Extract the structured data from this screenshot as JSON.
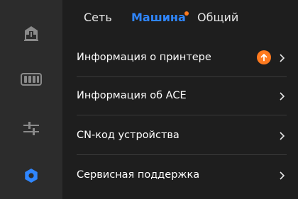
{
  "sidebar": {
    "items": [
      {
        "icon": "printer-icon",
        "active": false
      },
      {
        "icon": "spool-rack-icon",
        "active": false
      },
      {
        "icon": "sliders-icon",
        "active": false
      },
      {
        "icon": "gear-icon",
        "active": true
      }
    ]
  },
  "tabs": [
    {
      "label": "Сеть",
      "active": false
    },
    {
      "label": "Машина",
      "active": true,
      "notification_dot": true
    },
    {
      "label": "Общий",
      "active": false
    }
  ],
  "menu": {
    "items": [
      {
        "label": "Информация о принтере",
        "update_badge": "arrow-up-icon"
      },
      {
        "label": "Информация об ACE"
      },
      {
        "label": "CN-код устройства"
      },
      {
        "label": "Сервисная поддержка"
      }
    ]
  },
  "colors": {
    "accent": "#2f86ff",
    "badge": "#ff7a1f",
    "sidebar_bg": "#2c2c2c",
    "main_bg": "#1e1e1e"
  }
}
